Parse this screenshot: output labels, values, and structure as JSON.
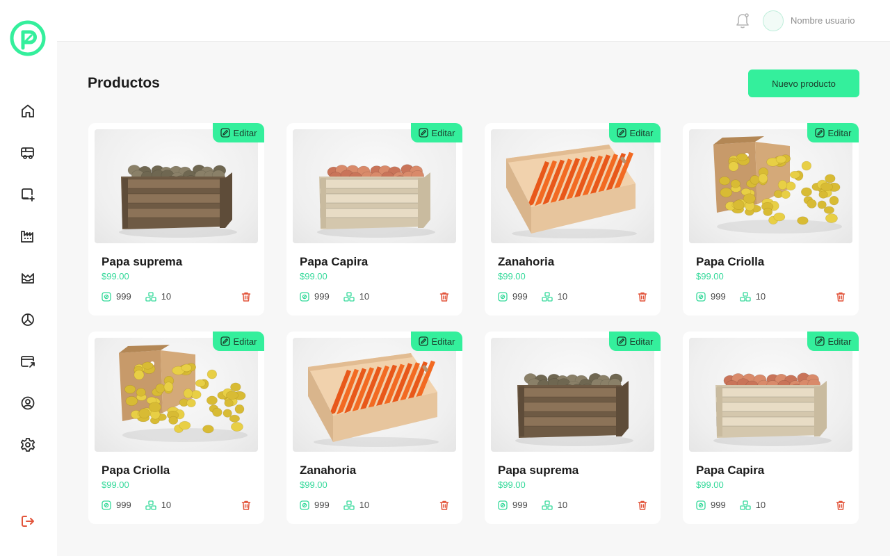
{
  "header": {
    "username": "Nombre usuario"
  },
  "page": {
    "title": "Productos",
    "new_button": "Nuevo producto"
  },
  "colors": {
    "accent": "#34ef9c",
    "price": "#34d99a",
    "delete": "#e2543a",
    "logout": "#e2543a"
  },
  "sidebar": {
    "items": [
      {
        "icon": "home-icon"
      },
      {
        "icon": "truck-icon"
      },
      {
        "icon": "add-product-icon"
      },
      {
        "icon": "factory-icon"
      },
      {
        "icon": "inbox-icon"
      },
      {
        "icon": "chart-pie-icon"
      },
      {
        "icon": "card-transfer-icon"
      },
      {
        "icon": "user-circle-icon"
      },
      {
        "icon": "gear-icon"
      }
    ],
    "logout_icon": "logout-icon"
  },
  "products": [
    {
      "name": "Papa suprema",
      "price": "$99.00",
      "stock": "999",
      "units": "10",
      "edit": "Editar",
      "image": "crate-brown-potatoes"
    },
    {
      "name": "Papa Capira",
      "price": "$99.00",
      "stock": "999",
      "units": "10",
      "edit": "Editar",
      "image": "crate-red-potatoes"
    },
    {
      "name": "Zanahoria",
      "price": "$99.00",
      "stock": "999",
      "units": "10",
      "edit": "Editar",
      "image": "tray-carrots"
    },
    {
      "name": "Papa Criolla",
      "price": "$99.00",
      "stock": "999",
      "units": "10",
      "edit": "Editar",
      "image": "box-yellow-potatoes"
    },
    {
      "name": "Papa Criolla",
      "price": "$99.00",
      "stock": "999",
      "units": "10",
      "edit": "Editar",
      "image": "box-yellow-potatoes"
    },
    {
      "name": "Zanahoria",
      "price": "$99.00",
      "stock": "999",
      "units": "10",
      "edit": "Editar",
      "image": "tray-carrots"
    },
    {
      "name": "Papa suprema",
      "price": "$99.00",
      "stock": "999",
      "units": "10",
      "edit": "Editar",
      "image": "crate-brown-potatoes"
    },
    {
      "name": "Papa Capira",
      "price": "$99.00",
      "stock": "999",
      "units": "10",
      "edit": "Editar",
      "image": "crate-red-potatoes"
    }
  ]
}
